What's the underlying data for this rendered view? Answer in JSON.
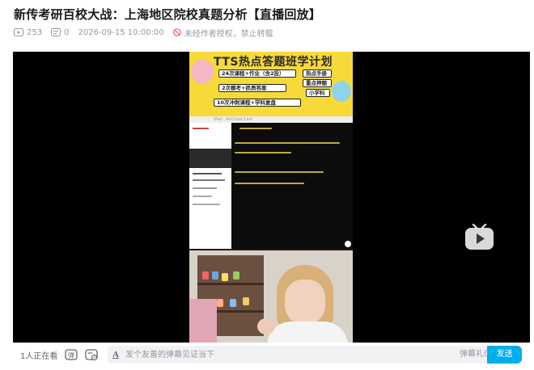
{
  "video": {
    "title": "新传考研百校大战：上海地区院校真题分析【直播回放】",
    "play_count": "253",
    "danmaku_count": "0",
    "publish_time": "2026-09-15 10:00:00",
    "copyright_notice": "未经作者授权，禁止转载"
  },
  "overlay": {
    "banner_title": "TTS热点答题班学计划",
    "banner_rows": [
      "24次课程+作业（含2投）",
      "2次模考+抓质答案",
      "10次冲刺课程+学科复盘",
      "热点手册",
      "重点押题",
      "小学科"
    ],
    "ipad_bar": "iPad · AirDroid Cast"
  },
  "controls": {
    "viewers": "1人正在看",
    "danmaku_icon": "danmaku-toggle-icon",
    "danmaku_settings_icon": "danmaku-settings-icon",
    "danmaku_placeholder": "发个友善的弹幕见证当下",
    "etiquette": "弹幕礼仪 ›",
    "send": "发送"
  },
  "colors": {
    "accent": "#00aeec",
    "player_bg": "#000000",
    "muted_text": "#9499a0",
    "warning": "#f25d59"
  }
}
